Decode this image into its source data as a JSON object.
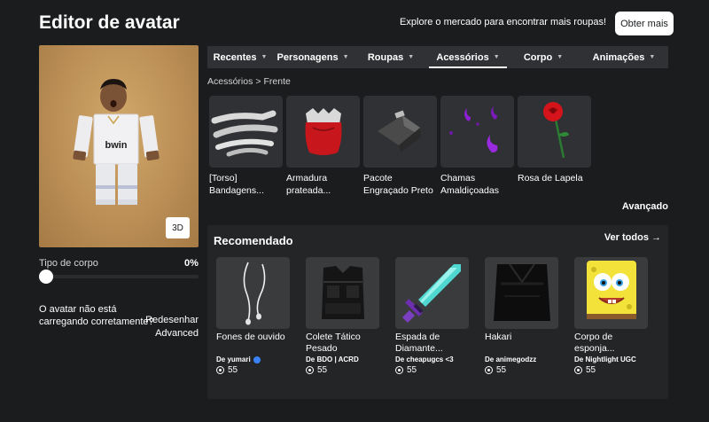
{
  "header": {
    "title": "Editor de avatar",
    "explore_text": "Explore o mercado para encontrar mais roupas!",
    "get_more_label": "Obter mais"
  },
  "avatar": {
    "view_3d_label": "3D",
    "body_type_label": "Tipo de corpo",
    "body_type_value": "0%",
    "body_type_fraction": 0,
    "issue_text": "O avatar não está carregando corretamente?",
    "redraw_label": "Redesenhar",
    "advanced_label": "Advanced",
    "shirt_text": "bwin"
  },
  "tabs": [
    {
      "label": "Recentes",
      "active": false
    },
    {
      "label": "Personagens",
      "active": false
    },
    {
      "label": "Roupas",
      "active": false
    },
    {
      "label": "Acessórios",
      "active": true
    },
    {
      "label": "Corpo",
      "active": false
    },
    {
      "label": "Animações",
      "active": false
    }
  ],
  "breadcrumb": {
    "parent": "Acessórios",
    "separator": ">",
    "current": "Frente"
  },
  "items": [
    {
      "name": "[Torso] Bandagens...",
      "icon": "bandages-icon"
    },
    {
      "name": "Armadura prateada...",
      "icon": "armor-icon"
    },
    {
      "name": "Pacote Engraçado Preto",
      "icon": "black-pack-icon"
    },
    {
      "name": "Chamas Amaldiçoadas",
      "icon": "cursed-flames-icon"
    },
    {
      "name": "Rosa de Lapela",
      "icon": "rose-icon"
    }
  ],
  "advanced_label": "Avançado",
  "recommended": {
    "title": "Recomendado",
    "see_all_label": "Ver todos →",
    "items": [
      {
        "name": "Fones de ouvido",
        "creator": "De yumari",
        "verified": true,
        "price": "55",
        "icon": "earphones-icon"
      },
      {
        "name": "Colete Tático Pesado",
        "creator": "De BDO | ACRD",
        "verified": false,
        "price": "55",
        "icon": "tactical-vest-icon"
      },
      {
        "name": "Espada de Diamante...",
        "creator": "De cheapugcs <3",
        "verified": false,
        "price": "55",
        "icon": "diamond-sword-icon"
      },
      {
        "name": "Hakari",
        "creator": "De animegodzz",
        "verified": false,
        "price": "55",
        "icon": "hakari-icon"
      },
      {
        "name": "Corpo de esponja...",
        "creator": "De Nightlight UGC",
        "verified": false,
        "price": "55",
        "icon": "sponge-body-icon"
      }
    ]
  },
  "colors": {
    "background": "#1a1c1e",
    "panel": "#232527",
    "tile": "#2f3134",
    "accent_white": "#ffffff"
  }
}
